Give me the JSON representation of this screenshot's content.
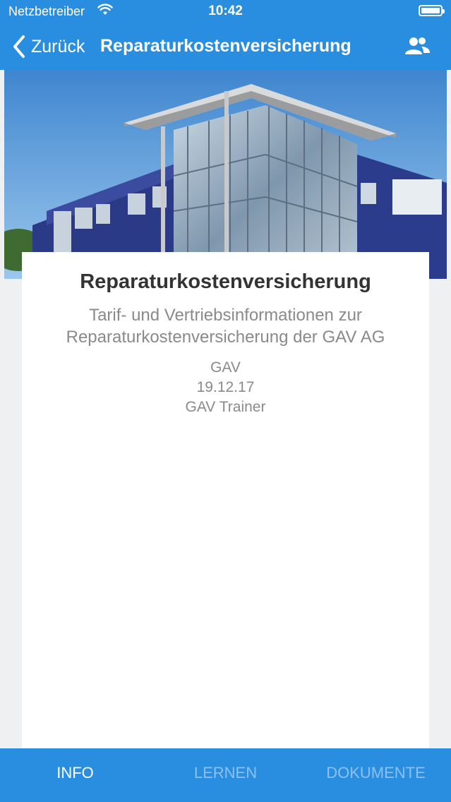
{
  "status_bar": {
    "carrier": "Netzbetreiber",
    "time": "10:42",
    "icons": [
      "wifi-icon",
      "battery-icon"
    ]
  },
  "nav": {
    "back_label": "Zurück",
    "title": "Reparaturkostenversicherung",
    "right_icon": "users-icon"
  },
  "hero": {
    "image": "building-photo"
  },
  "card": {
    "title": "Reparaturkostenversicherung",
    "subtitle_line1": "Tarif- und Vertriebsinformationen zur",
    "subtitle_line2": "Reparaturkostenversicherung der GAV AG",
    "publisher": "GAV",
    "date": "19.12.17",
    "author": "GAV Trainer"
  },
  "tabs": [
    {
      "label": "INFO",
      "active": true
    },
    {
      "label": "LERNEN",
      "active": false
    },
    {
      "label": "DOKUMENTE",
      "active": false
    }
  ],
  "colors": {
    "primary": "#2a8ee0",
    "background": "#eef0f2",
    "tab_inactive": "#8cc0ee",
    "text_dark": "#333333",
    "text_muted": "#8a8a8a"
  }
}
